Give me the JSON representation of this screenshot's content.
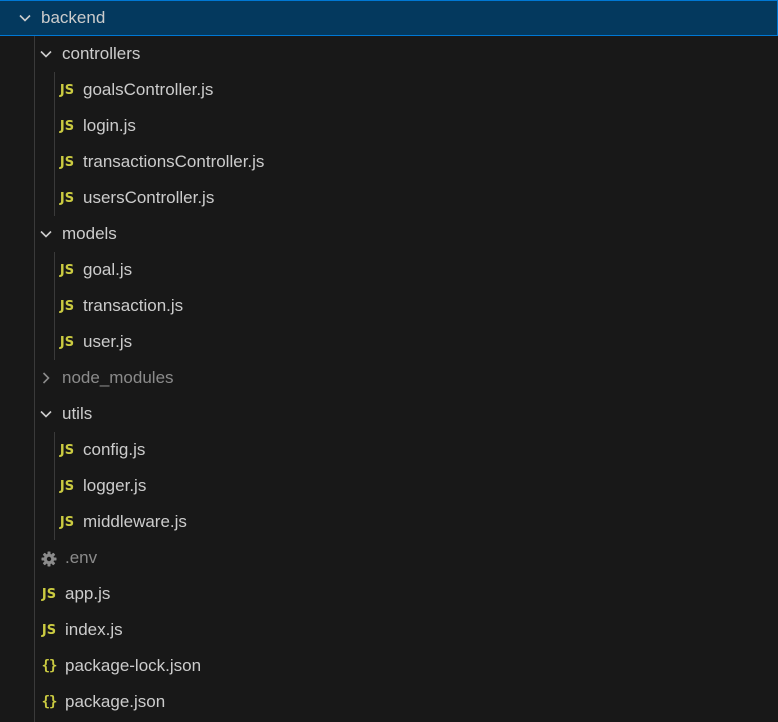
{
  "explorer": {
    "root": {
      "label": "backend",
      "expanded": true
    },
    "folders": {
      "controllers": {
        "label": "controllers",
        "expanded": true,
        "files": [
          {
            "label": "goalsController.js",
            "icon": "js-icon",
            "icon_text": "JS"
          },
          {
            "label": "login.js",
            "icon": "js-icon",
            "icon_text": "JS"
          },
          {
            "label": "transactionsController.js",
            "icon": "js-icon",
            "icon_text": "JS"
          },
          {
            "label": "usersController.js",
            "icon": "js-icon",
            "icon_text": "JS"
          }
        ]
      },
      "models": {
        "label": "models",
        "expanded": true,
        "files": [
          {
            "label": "goal.js",
            "icon": "js-icon",
            "icon_text": "JS"
          },
          {
            "label": "transaction.js",
            "icon": "js-icon",
            "icon_text": "JS"
          },
          {
            "label": "user.js",
            "icon": "js-icon",
            "icon_text": "JS"
          }
        ]
      },
      "node_modules": {
        "label": "node_modules",
        "expanded": false
      },
      "utils": {
        "label": "utils",
        "expanded": true,
        "files": [
          {
            "label": "config.js",
            "icon": "js-icon",
            "icon_text": "JS"
          },
          {
            "label": "logger.js",
            "icon": "js-icon",
            "icon_text": "JS"
          },
          {
            "label": "middleware.js",
            "icon": "js-icon",
            "icon_text": "JS"
          }
        ]
      }
    },
    "root_files": [
      {
        "label": ".env",
        "icon": "gear-icon"
      },
      {
        "label": "app.js",
        "icon": "js-icon",
        "icon_text": "JS"
      },
      {
        "label": "index.js",
        "icon": "js-icon",
        "icon_text": "JS"
      },
      {
        "label": "package-lock.json",
        "icon": "json-braces-icon",
        "icon_text": "{}"
      },
      {
        "label": "package.json",
        "icon": "json-braces-icon",
        "icon_text": "{}"
      }
    ]
  },
  "colors": {
    "background": "#181818",
    "selection": "#04395e",
    "focus_border": "#0078d4",
    "text": "#cccccc",
    "dimmed_text": "#8b8b8b",
    "js_icon": "#cbcb41"
  }
}
